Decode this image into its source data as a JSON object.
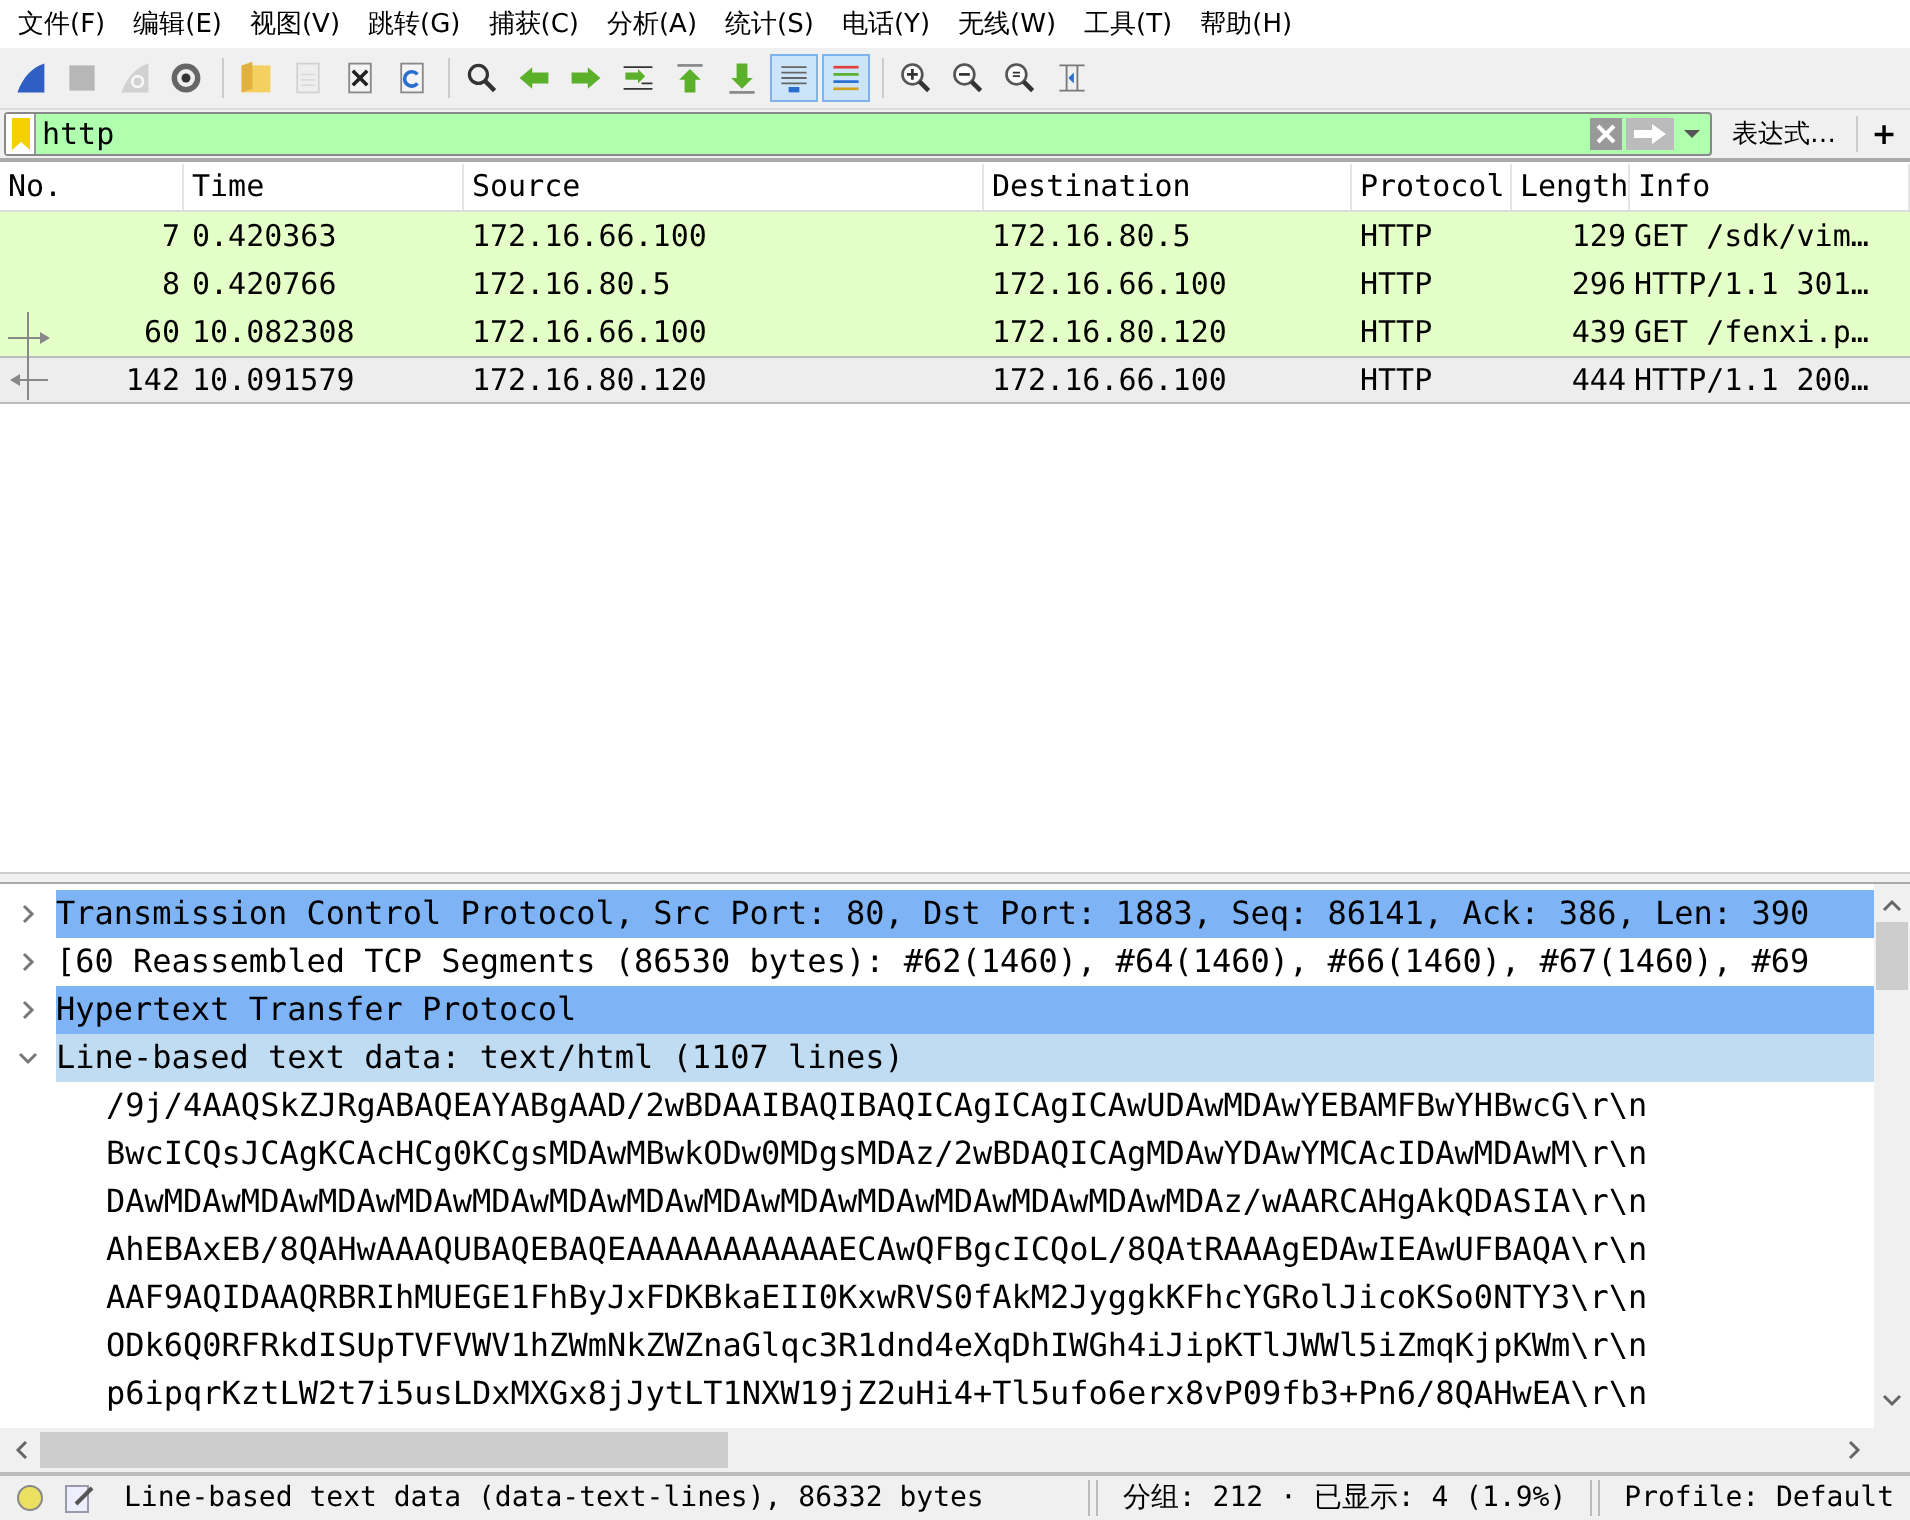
{
  "menu": [
    "文件(F)",
    "编辑(E)",
    "视图(V)",
    "跳转(G)",
    "捕获(C)",
    "分析(A)",
    "统计(S)",
    "电话(Y)",
    "无线(W)",
    "工具(T)",
    "帮助(H)"
  ],
  "toolbar": [
    {
      "kind": "start",
      "disabled": false,
      "pressed": false
    },
    {
      "kind": "stop",
      "disabled": true,
      "pressed": false
    },
    {
      "kind": "restart",
      "disabled": true,
      "pressed": false
    },
    {
      "kind": "options",
      "disabled": false,
      "pressed": false
    },
    {
      "kind": "open",
      "disabled": false,
      "pressed": false
    },
    {
      "kind": "save",
      "disabled": true,
      "pressed": false
    },
    {
      "kind": "close",
      "disabled": false,
      "pressed": false
    },
    {
      "kind": "reload",
      "disabled": false,
      "pressed": false
    },
    {
      "kind": "find",
      "disabled": false,
      "pressed": false
    },
    {
      "kind": "back",
      "disabled": false,
      "pressed": false
    },
    {
      "kind": "forward",
      "disabled": false,
      "pressed": false
    },
    {
      "kind": "goto",
      "disabled": false,
      "pressed": false
    },
    {
      "kind": "first",
      "disabled": false,
      "pressed": false
    },
    {
      "kind": "last",
      "disabled": false,
      "pressed": false
    },
    {
      "kind": "autoscroll",
      "disabled": false,
      "pressed": true
    },
    {
      "kind": "colorize",
      "disabled": false,
      "pressed": true
    },
    {
      "kind": "zoomin",
      "disabled": false,
      "pressed": false
    },
    {
      "kind": "zoomout",
      "disabled": false,
      "pressed": false
    },
    {
      "kind": "zoomreset",
      "disabled": false,
      "pressed": false
    },
    {
      "kind": "resize",
      "disabled": false,
      "pressed": false
    }
  ],
  "filter": {
    "value": "http",
    "expression_button": "表达式…",
    "add_button": "+"
  },
  "packet_list": {
    "columns": [
      "No.",
      "Time",
      "Source",
      "Destination",
      "Protocol",
      "Length",
      "Info"
    ],
    "rows": [
      {
        "no": "7",
        "time": "0.420363",
        "source": "172.16.66.100",
        "destination": "172.16.80.5",
        "protocol": "HTTP",
        "length": "129",
        "info": "GET /sdk/vim…",
        "selected": false,
        "request_marker": false,
        "response_marker": false
      },
      {
        "no": "8",
        "time": "0.420766",
        "source": "172.16.80.5",
        "destination": "172.16.66.100",
        "protocol": "HTTP",
        "length": "296",
        "info": "HTTP/1.1 301…",
        "selected": false,
        "request_marker": false,
        "response_marker": false
      },
      {
        "no": "60",
        "time": "10.082308",
        "source": "172.16.66.100",
        "destination": "172.16.80.120",
        "protocol": "HTTP",
        "length": "439",
        "info": "GET /fenxi.p…",
        "selected": false,
        "request_marker": true,
        "response_marker": false
      },
      {
        "no": "142",
        "time": "10.091579",
        "source": "172.16.80.120",
        "destination": "172.16.66.100",
        "protocol": "HTTP",
        "length": "444",
        "info": "HTTP/1.1 200…",
        "selected": true,
        "request_marker": false,
        "response_marker": true
      }
    ]
  },
  "details": [
    {
      "label": "Transmission Control Protocol, Src Port: 80, Dst Port: 1883, Seq: 86141, Ack: 386, Len: 390",
      "expanded": false,
      "highlighted": true,
      "selected": false
    },
    {
      "label": "[60 Reassembled TCP Segments (86530 bytes): #62(1460), #64(1460), #66(1460), #67(1460), #69",
      "expanded": false,
      "highlighted": false,
      "selected": false
    },
    {
      "label": "Hypertext Transfer Protocol",
      "expanded": false,
      "highlighted": true,
      "selected": false
    },
    {
      "label": "Line-based text data: text/html (1107 lines)",
      "expanded": true,
      "highlighted": false,
      "selected": true,
      "children": [
        {
          "label": "/9j/4AAQSkZJRgABAQEAYABgAAD/2wBDAAIBAQIBAQICAgICAgICAwUDAwMDAwYEBAMFBwYHBwcG\\r\\n"
        },
        {
          "label": "BwcICQsJCAgKCAcHCg0KCgsMDAwMBwkODw0MDgsMDAz/2wBDAQICAgMDAwYDAwYMCAcIDAwMDAwM\\r\\n"
        },
        {
          "label": "DAwMDAwMDAwMDAwMDAwMDAwMDAwMDAwMDAwMDAwMDAwMDAwMDAwMDAwMDAz/wAARCAHgAkQDASIA\\r\\n"
        },
        {
          "label": "AhEBAxEB/8QAHwAAAQUBAQEBAQEAAAAAAAAAAAECAwQFBgcICQoL/8QAtRAAAgEDAwIEAwUFBAQA\\r\\n"
        },
        {
          "label": "AAF9AQIDAAQRBRIhMUEGE1FhByJxFDKBkaEII0KxwRVS0fAkM2JyggkKFhcYGRolJicoKSo0NTY3\\r\\n"
        },
        {
          "label": "ODk6Q0RFRkdISUpTVFVWV1hZWmNkZWZnaGlqc3R1dnd4eXqDhIWGh4iJipKTlJWWl5iZmqKjpKWm\\r\\n"
        },
        {
          "label": "p6ipqrKztLW2t7i5usLDxMXGx8jJytLT1NXW19jZ2uHi4+Tl5ufo6erx8vP09fb3+Pn6/8QAHwEA\\r\\n"
        }
      ]
    }
  ],
  "status_bar": {
    "selection": "Line-based text data (data-text-lines), 86332 bytes",
    "counts": "分组: 212 · 已显示: 4 (1.9%)",
    "profile": "Profile: Default"
  }
}
